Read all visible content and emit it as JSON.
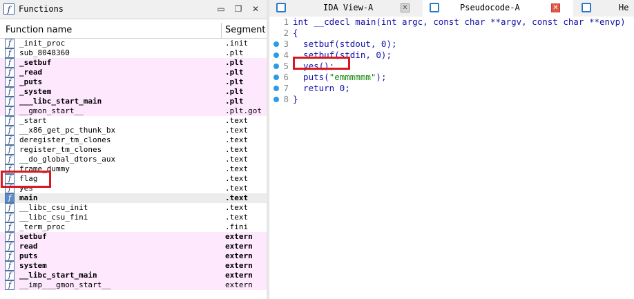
{
  "functions_panel": {
    "title": "Functions",
    "columns": {
      "name": "Function name",
      "segment": "Segment"
    },
    "rows": [
      {
        "name": "_init_proc",
        "segment": ".init",
        "style": "normal"
      },
      {
        "name": "sub_8048360",
        "segment": ".plt",
        "style": "normal"
      },
      {
        "name": "_setbuf",
        "segment": ".plt",
        "style": "plt"
      },
      {
        "name": "_read",
        "segment": ".plt",
        "style": "plt"
      },
      {
        "name": "_puts",
        "segment": ".plt",
        "style": "plt"
      },
      {
        "name": "_system",
        "segment": ".plt",
        "style": "plt"
      },
      {
        "name": "___libc_start_main",
        "segment": ".plt",
        "style": "plt"
      },
      {
        "name": "__gmon_start__",
        "segment": ".plt.got",
        "style": "pltgot"
      },
      {
        "name": "_start",
        "segment": ".text",
        "style": "normal"
      },
      {
        "name": "__x86_get_pc_thunk_bx",
        "segment": ".text",
        "style": "normal"
      },
      {
        "name": "deregister_tm_clones",
        "segment": ".text",
        "style": "normal"
      },
      {
        "name": "register_tm_clones",
        "segment": ".text",
        "style": "normal"
      },
      {
        "name": "__do_global_dtors_aux",
        "segment": ".text",
        "style": "normal"
      },
      {
        "name": "frame_dummy",
        "segment": ".text",
        "style": "normal"
      },
      {
        "name": "flag",
        "segment": ".text",
        "style": "normal"
      },
      {
        "name": "yes",
        "segment": ".text",
        "style": "normal"
      },
      {
        "name": "main",
        "segment": ".text",
        "style": "selected"
      },
      {
        "name": "__libc_csu_init",
        "segment": ".text",
        "style": "normal"
      },
      {
        "name": "__libc_csu_fini",
        "segment": ".text",
        "style": "normal"
      },
      {
        "name": "_term_proc",
        "segment": ".fini",
        "style": "normal"
      },
      {
        "name": "setbuf",
        "segment": "extern",
        "style": "extern"
      },
      {
        "name": "read",
        "segment": "extern",
        "style": "extern"
      },
      {
        "name": "puts",
        "segment": "extern",
        "style": "extern"
      },
      {
        "name": "system",
        "segment": "extern",
        "style": "extern"
      },
      {
        "name": "__libc_start_main",
        "segment": "extern",
        "style": "extern"
      },
      {
        "name": "__imp___gmon_start__",
        "segment": "extern",
        "style": "pltgot"
      }
    ]
  },
  "tabs": [
    {
      "label": "IDA View-A",
      "active": false
    },
    {
      "label": "Pseudocode-A",
      "active": true
    },
    {
      "label": "He",
      "active": false
    }
  ],
  "code_lines": [
    {
      "num": "1",
      "dot": false,
      "code": "int __cdecl main(int argc, const char **argv, const char **envp)"
    },
    {
      "num": "2",
      "dot": false,
      "code": "{"
    },
    {
      "num": "3",
      "dot": true,
      "code": "  setbuf(stdout, 0);"
    },
    {
      "num": "4",
      "dot": true,
      "code": "  setbuf(stdin, 0);"
    },
    {
      "num": "5",
      "dot": true,
      "code": "  yes();"
    },
    {
      "num": "6",
      "dot": true,
      "code": "  puts(\"emmmmmm\");"
    },
    {
      "num": "7",
      "dot": true,
      "code": "  return 0;"
    },
    {
      "num": "8",
      "dot": true,
      "code": "}"
    }
  ],
  "colors": {
    "plt_row": "#fde8fd",
    "highlight_box": "#d9171e",
    "code_text": "#1111aa",
    "string": "#118811",
    "breakpoint_dot": "#2b9be6"
  }
}
